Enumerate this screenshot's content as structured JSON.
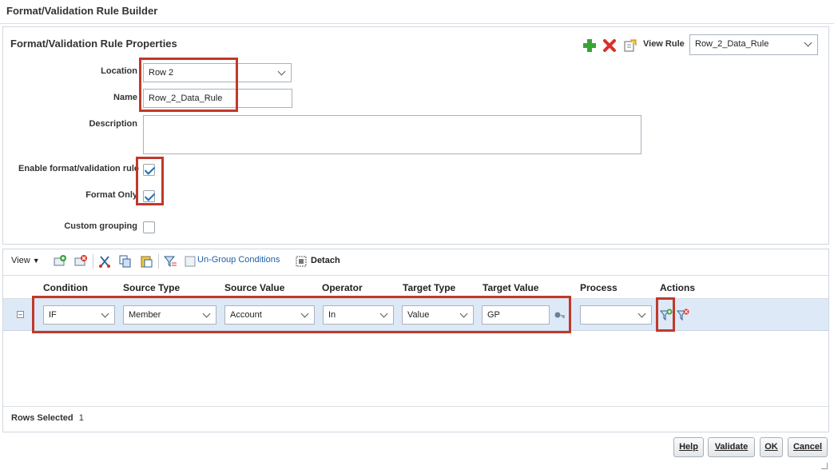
{
  "window": {
    "title": "Format/Validation Rule Builder"
  },
  "properties": {
    "title": "Format/Validation Rule Properties",
    "view_rule_label": "View Rule",
    "view_rule_value": "Row_2_Data_Rule",
    "location_label": "Location",
    "location_value": "Row 2",
    "name_label": "Name",
    "name_value": "Row_2_Data_Rule",
    "description_label": "Description",
    "description_value": "",
    "enable_label": "Enable format/validation rule",
    "enable_checked": true,
    "format_only_label": "Format Only",
    "format_only_checked": true,
    "custom_grouping_label": "Custom grouping",
    "custom_grouping_checked": false
  },
  "toolbar": {
    "view_label": "View",
    "ungroup_label": "Un-Group Conditions",
    "detach_label": "Detach"
  },
  "grid": {
    "columns": [
      "Condition",
      "Source Type",
      "Source Value",
      "Operator",
      "Target Type",
      "Target Value",
      "Process",
      "Actions"
    ],
    "row": {
      "condition": "IF",
      "source_type": "Member",
      "source_value": "Account",
      "operator": "In",
      "target_type": "Value",
      "target_value": "GP",
      "process": ""
    },
    "footer_label": "Rows Selected",
    "rows_selected": "1"
  },
  "buttons": {
    "help": "Help",
    "validate": "Validate",
    "ok": "OK",
    "cancel": "Cancel"
  },
  "colors": {
    "highlight": "#c0392b",
    "row_selected": "#dde9f7",
    "add_green": "#3aa335",
    "delete_red": "#d93025"
  }
}
